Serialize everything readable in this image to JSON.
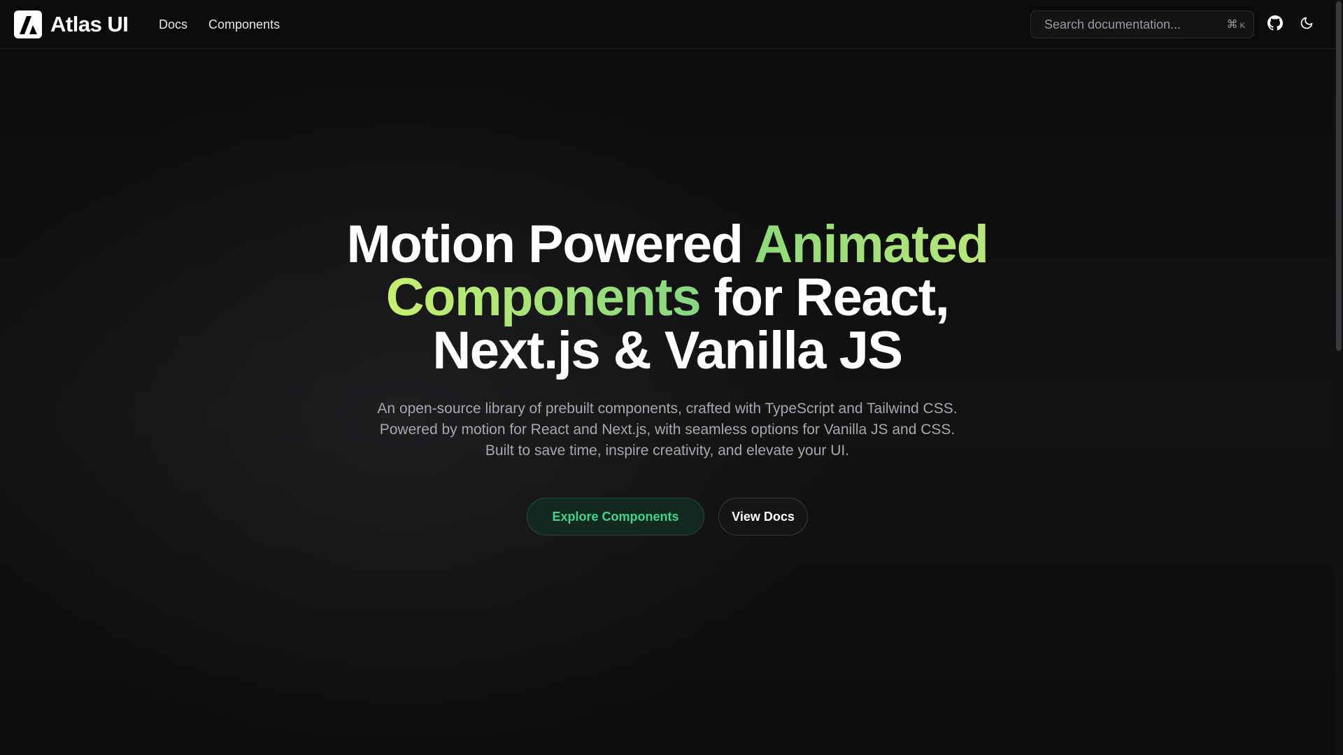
{
  "header": {
    "brand": {
      "name": "Atlas UI",
      "logo_icon": "atlas-logo-icon"
    },
    "nav": [
      {
        "label": "Docs"
      },
      {
        "label": "Components"
      }
    ],
    "search": {
      "placeholder": "Search documentation...",
      "shortcut_symbol": "⌘",
      "shortcut_key": "K",
      "icon": "command-icon"
    },
    "icons": {
      "github": "github-icon",
      "theme_toggle": "moon-icon"
    }
  },
  "hero": {
    "headline": {
      "part1": "Motion Powered ",
      "accent1": "Animated",
      "accent2": "Components",
      "part2": " for React,",
      "line3": "Next.js & Vanilla JS"
    },
    "subtitle": "An open-source library of prebuilt components, crafted with TypeScript and Tailwind CSS. Powered by motion for React and Next.js, with seamless options for Vanilla JS and CSS. Built to save time, inspire creativity, and elevate your UI.",
    "actions": {
      "primary_label": "Explore Components",
      "secondary_label": "View Docs"
    }
  },
  "colors": {
    "background": "#0c0c0c",
    "accent_green_start": "#8ed97a",
    "accent_green_end": "#c7ef6e",
    "primary_button_text": "#3fd48f",
    "primary_button_bg": "#13281f",
    "subtitle_text": "#a8a8ad"
  }
}
